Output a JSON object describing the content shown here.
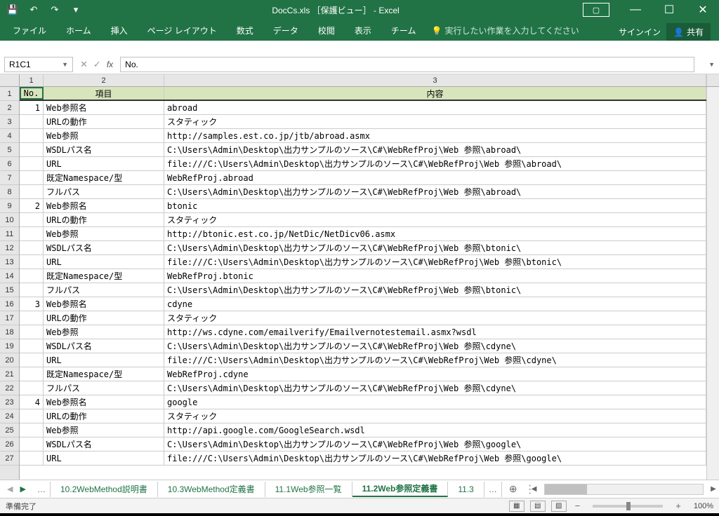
{
  "title": "DocCs.xls ［保護ビュー］ - Excel",
  "qat": {
    "save": "💾",
    "undo": "↶",
    "redo": "↷",
    "more": "▾"
  },
  "ribbon": [
    "ファイル",
    "ホーム",
    "挿入",
    "ページ レイアウト",
    "数式",
    "データ",
    "校閲",
    "表示",
    "チーム"
  ],
  "tellme": "実行したい作業を入力してください",
  "signin": "サインイン",
  "share": "共有",
  "namebox": "R1C1",
  "formula_value": "No.",
  "col_headers": [
    "1",
    "2",
    "3"
  ],
  "chart_data": {
    "type": "table",
    "title": "11.2Web参照定義書",
    "columns": [
      "No.",
      "項目",
      "内容"
    ],
    "rows": [
      [
        "1",
        "Web参照名",
        "abroad"
      ],
      [
        "",
        "URLの動作",
        "スタティック"
      ],
      [
        "",
        "Web参照",
        "http://samples.est.co.jp/jtb/abroad.asmx"
      ],
      [
        "",
        "WSDLパス名",
        "C:\\Users\\Admin\\Desktop\\出力サンプルのソース\\C#\\WebRefProj\\Web 参照\\abroad\\"
      ],
      [
        "",
        "URL",
        "file:///C:\\Users\\Admin\\Desktop\\出力サンプルのソース\\C#\\WebRefProj\\Web 参照\\abroad\\"
      ],
      [
        "",
        "既定Namespace/型",
        "WebRefProj.abroad"
      ],
      [
        "",
        "フルパス",
        "C:\\Users\\Admin\\Desktop\\出力サンプルのソース\\C#\\WebRefProj\\Web 参照\\abroad\\"
      ],
      [
        "2",
        "Web参照名",
        "btonic"
      ],
      [
        "",
        "URLの動作",
        "スタティック"
      ],
      [
        "",
        "Web参照",
        "http://btonic.est.co.jp/NetDic/NetDicv06.asmx"
      ],
      [
        "",
        "WSDLパス名",
        "C:\\Users\\Admin\\Desktop\\出力サンプルのソース\\C#\\WebRefProj\\Web 参照\\btonic\\"
      ],
      [
        "",
        "URL",
        "file:///C:\\Users\\Admin\\Desktop\\出力サンプルのソース\\C#\\WebRefProj\\Web 参照\\btonic\\"
      ],
      [
        "",
        "既定Namespace/型",
        "WebRefProj.btonic"
      ],
      [
        "",
        "フルパス",
        "C:\\Users\\Admin\\Desktop\\出力サンプルのソース\\C#\\WebRefProj\\Web 参照\\btonic\\"
      ],
      [
        "3",
        "Web参照名",
        "cdyne"
      ],
      [
        "",
        "URLの動作",
        "スタティック"
      ],
      [
        "",
        "Web参照",
        "http://ws.cdyne.com/emailverify/Emailvernotestemail.asmx?wsdl"
      ],
      [
        "",
        "WSDLパス名",
        "C:\\Users\\Admin\\Desktop\\出力サンプルのソース\\C#\\WebRefProj\\Web 参照\\cdyne\\"
      ],
      [
        "",
        "URL",
        "file:///C:\\Users\\Admin\\Desktop\\出力サンプルのソース\\C#\\WebRefProj\\Web 参照\\cdyne\\"
      ],
      [
        "",
        "既定Namespace/型",
        "WebRefProj.cdyne"
      ],
      [
        "",
        "フルパス",
        "C:\\Users\\Admin\\Desktop\\出力サンプルのソース\\C#\\WebRefProj\\Web 参照\\cdyne\\"
      ],
      [
        "4",
        "Web参照名",
        "google"
      ],
      [
        "",
        "URLの動作",
        "スタティック"
      ],
      [
        "",
        "Web参照",
        "http://api.google.com/GoogleSearch.wsdl"
      ],
      [
        "",
        "WSDLパス名",
        "C:\\Users\\Admin\\Desktop\\出力サンプルのソース\\C#\\WebRefProj\\Web 参照\\google\\"
      ],
      [
        "",
        "URL",
        "file:///C:\\Users\\Admin\\Desktop\\出力サンプルのソース\\C#\\WebRefProj\\Web 参照\\google\\"
      ]
    ]
  },
  "sheet_tabs": [
    "10.2WebMethod説明書",
    "10.3WebMethod定義書",
    "11.1Web参照一覧",
    "11.2Web参照定義書",
    "11.3"
  ],
  "active_tab": 3,
  "status": "準備完了",
  "zoom": "100%"
}
